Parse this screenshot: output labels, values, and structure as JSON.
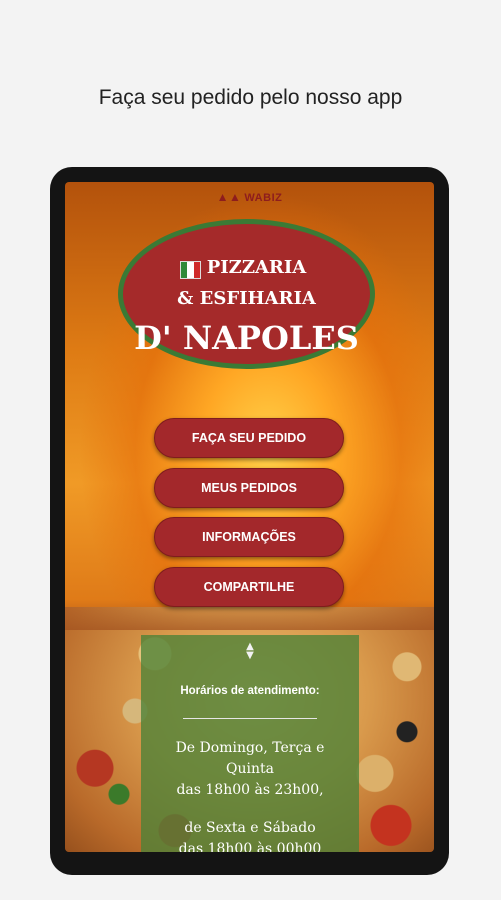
{
  "promo_text": "Faça seu pedido pelo nosso app",
  "brand": {
    "name": "WABIZ",
    "icon": "wabiz-logo-icon"
  },
  "logo": {
    "line1": "PIZZARIA",
    "line2": "& ESFIHARIA",
    "line3": "D' NAPOLES",
    "flag_colors": [
      "#2f8a3a",
      "#ffffff",
      "#cf2b2b"
    ]
  },
  "menu": [
    {
      "label": "FAÇA SEU PEDIDO"
    },
    {
      "label": "MEUS PEDIDOS"
    },
    {
      "label": "INFORMAÇÕES"
    },
    {
      "label": "COMPARTILHE"
    }
  ],
  "hours": {
    "title": "Horários de atendimento:",
    "block1_line1": "De Domingo, Terça e",
    "block1_line2": "Quinta",
    "block1_line3": "das 18h00 às 23h00,",
    "block2_line1": "de Sexta e Sábado",
    "block2_line2": "das 18h00 às 00h00"
  },
  "colors": {
    "button": "#a3282b",
    "logo_bg": "#a52a2a",
    "logo_border": "#3b7a35",
    "hours_panel": "#4b8237"
  }
}
